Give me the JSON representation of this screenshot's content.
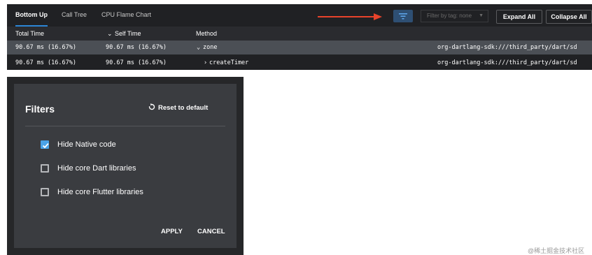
{
  "tabs": [
    {
      "label": "Bottom Up",
      "active": true
    },
    {
      "label": "Call Tree",
      "active": false
    },
    {
      "label": "CPU Flame Chart",
      "active": false
    }
  ],
  "toolbar": {
    "tag_filter": "Filter by tag: none",
    "expand_all": "Expand All",
    "collapse_all": "Collapse All",
    "accent_color": "#2c86d6",
    "annotation_arrow_color": "#e8432b"
  },
  "columns": {
    "total_time": "Total Time",
    "self_time": "Self Time",
    "method": "Method",
    "sort_indicator": "⌄"
  },
  "rows": [
    {
      "total": "90.67 ms (16.67%)",
      "self": "90.67 ms (16.67%)",
      "toggle": "⌄",
      "method": "zone",
      "source": "org-dartlang-sdk:///third_party/dart/sd",
      "selected": true
    },
    {
      "total": "90.67 ms (16.67%)",
      "self": "90.67 ms (16.67%)",
      "toggle": "›",
      "method": "createTimer",
      "source": "org-dartlang-sdk:///third_party/dart/sd",
      "selected": false
    }
  ],
  "dialog": {
    "title": "Filters",
    "reset_label": "Reset to default",
    "options": [
      {
        "label": "Hide Native code",
        "checked": true
      },
      {
        "label": "Hide core Dart libraries",
        "checked": false
      },
      {
        "label": "Hide core Flutter libraries",
        "checked": false
      }
    ],
    "apply_label": "APPLY",
    "cancel_label": "CANCEL",
    "checkbox_color": "#4aa3e8"
  },
  "watermark": "@稀土掘金技术社区"
}
